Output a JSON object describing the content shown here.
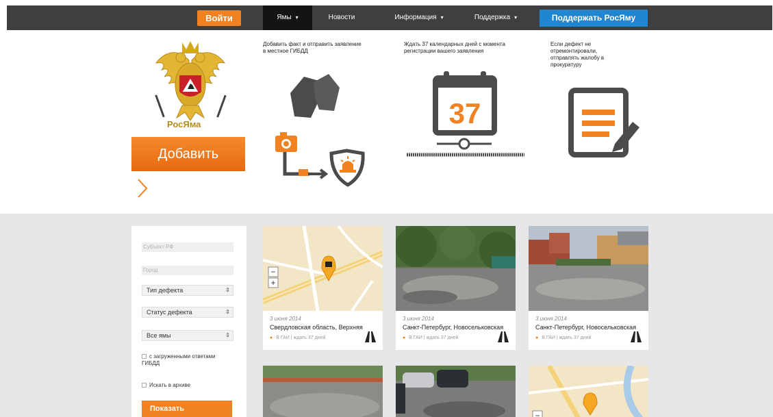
{
  "header": {
    "login": "Войти",
    "nav": [
      {
        "label": "Ямы",
        "caret": "▾"
      },
      {
        "label": "Новости",
        "caret": ""
      },
      {
        "label": "Информация",
        "caret": "▾"
      },
      {
        "label": "Поддержка",
        "caret": "▾"
      }
    ],
    "support": "Поддержать РосЯму"
  },
  "hero": {
    "logo_text": "РосЯма",
    "add_button": "Добавить",
    "steps": [
      {
        "text": "Добавить факт и отправить заявление в местное ГИБДД"
      },
      {
        "text": "Ждать 37 календарных дней с момента регистрации вашего заявления",
        "number": "37"
      },
      {
        "text": "Если дефект не отремонтировали, отправлять жалобу в прокуратуру"
      }
    ]
  },
  "filters": {
    "region_placeholder": "Субъект РФ",
    "city_placeholder": "Город",
    "defect_type": "Тип дефекта",
    "defect_status": "Статус дефекта",
    "pits": "Все ямы",
    "with_answers": "с загруженными ответами ГИБДД",
    "archive": "Искать в архиве",
    "show": "Показать"
  },
  "cards": [
    {
      "date": "3 июня 2014",
      "address": "Свердловская область, Верхняя",
      "authority": "В ГАИ",
      "status": "ждать 37 дней",
      "image": "map"
    },
    {
      "date": "3 июня 2014",
      "address": "Санкт-Петербург, Новосельковская",
      "authority": "В ГАИ",
      "status": "ждать 37 дней",
      "image": "photo-puddle"
    },
    {
      "date": "3 июня 2014",
      "address": "Санкт-Петербург, Новосельковская",
      "authority": "В ГАИ",
      "status": "ждать 37 дней",
      "image": "photo-yard"
    }
  ],
  "colors": {
    "accent": "#f08222",
    "topbar": "#3f3f3f",
    "blue": "#1f86d2",
    "lower_bg": "#e7e7e9"
  }
}
